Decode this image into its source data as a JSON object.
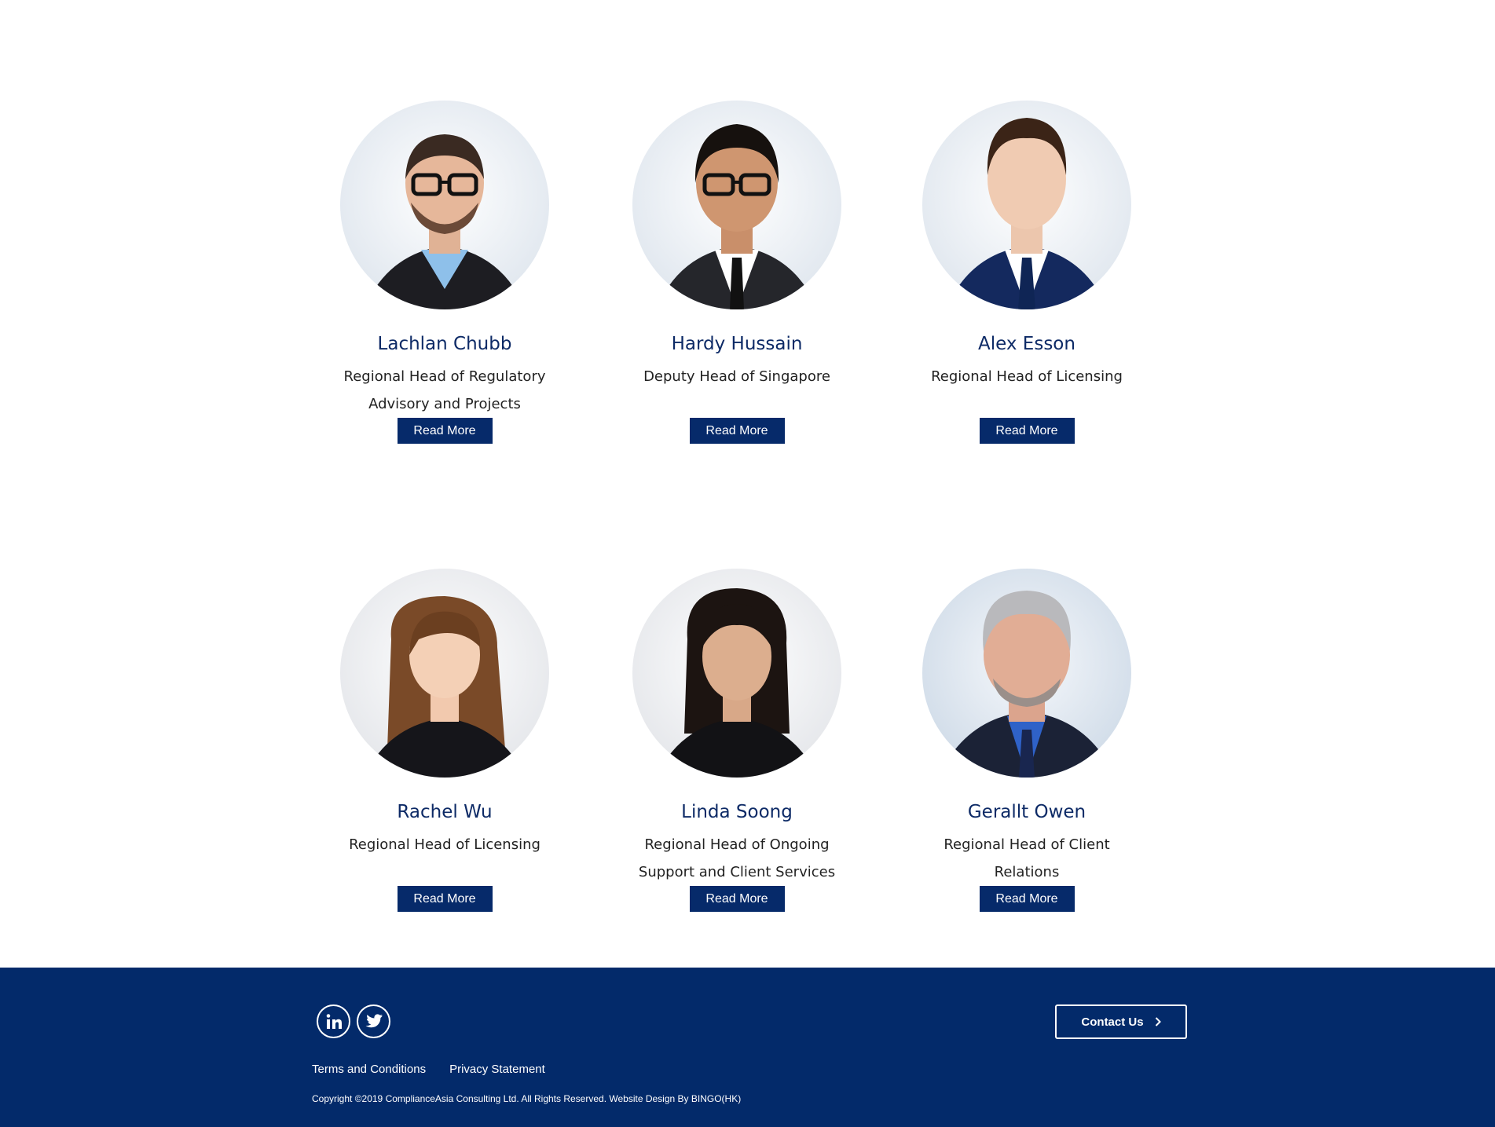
{
  "team": [
    {
      "name": "Lachlan Chubb",
      "role": "Regional Head of Regulatory Advisory and Projects",
      "button": "Read More",
      "photo": "portrait-man-glasses-beard"
    },
    {
      "name": "Hardy Hussain",
      "role": "Deputy Head of Singapore",
      "button": "Read More",
      "photo": "portrait-man-glasses-suit"
    },
    {
      "name": "Alex Esson",
      "role": "Regional Head of Licensing",
      "button": "Read More",
      "photo": "portrait-man-navy-suit"
    },
    {
      "name": "Rachel Wu",
      "role": "Regional Head of Licensing",
      "button": "Read More",
      "photo": "portrait-woman-long-hair"
    },
    {
      "name": "Linda Soong",
      "role": "Regional Head of Ongoing Support and Client Services",
      "button": "Read More",
      "photo": "portrait-woman-dark-hair"
    },
    {
      "name": "Gerallt Owen",
      "role": "Regional Head of Client Relations",
      "button": "Read More",
      "photo": "portrait-man-grey-hair"
    }
  ],
  "footer": {
    "social": [
      {
        "icon": "linkedin-icon"
      },
      {
        "icon": "twitter-icon"
      }
    ],
    "contact_label": "Contact Us",
    "links": [
      "Terms and Conditions",
      "Privacy Statement"
    ],
    "copyright": "Copyright ©2019 ComplianceAsia Consulting Ltd. All Rights Reserved. Website Design By BINGO(HK)"
  },
  "colors": {
    "brand_navy": "#032a6a",
    "button_navy": "#062a6a",
    "name_blue": "#0d2a66"
  }
}
